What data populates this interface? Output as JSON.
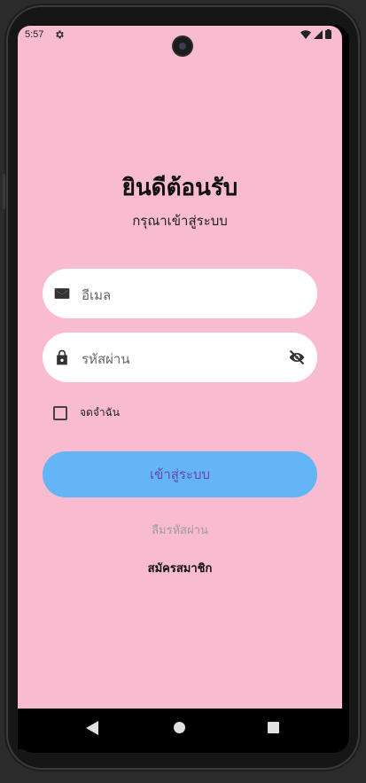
{
  "status_bar": {
    "time": "5:57",
    "settings_icon": "gear-icon",
    "wifi_icon": "wifi-icon",
    "signal_icon": "signal-icon",
    "battery_icon": "battery-icon"
  },
  "login": {
    "title": "ยินดีต้อนรับ",
    "subtitle": "กรุณาเข้าสู่ระบบ",
    "email": {
      "placeholder": "อีเมล",
      "icon": "mail-icon"
    },
    "password": {
      "placeholder": "รหัสผ่าน",
      "icon": "lock-icon",
      "toggle_icon": "eye-off-icon"
    },
    "remember_me": {
      "label": "จดจำฉัน",
      "checked": false
    },
    "login_button": "เข้าสู่ระบบ",
    "forgot_password": "ลืมรหัสผ่าน",
    "register": "สมัครสมาชิก"
  },
  "colors": {
    "background": "#f8bbd0",
    "button": "#64b5f6",
    "button_text": "#6a46b0"
  },
  "nav_bar": {
    "back_icon": "back-triangle-icon",
    "home_icon": "home-circle-icon",
    "recents_icon": "recents-square-icon"
  }
}
